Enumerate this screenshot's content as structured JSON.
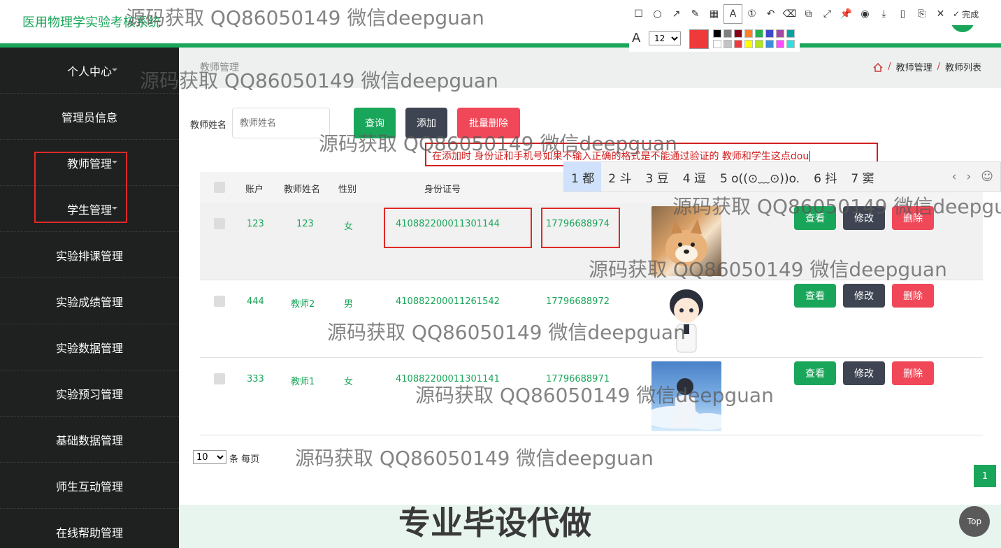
{
  "app": {
    "title": "医用物理学实验考核系统"
  },
  "sidebar": {
    "items": [
      {
        "label": "个人中心"
      },
      {
        "label": "管理员信息"
      },
      {
        "label": "教师管理"
      },
      {
        "label": "学生管理"
      },
      {
        "label": "实验排课管理"
      },
      {
        "label": "实验成绩管理"
      },
      {
        "label": "实验数据管理"
      },
      {
        "label": "实验预习管理"
      },
      {
        "label": "基础数据管理"
      },
      {
        "label": "师生互动管理"
      },
      {
        "label": "在线帮助管理"
      }
    ]
  },
  "breadcrumb": {
    "page_title": "教师管理",
    "trail": [
      "教师管理",
      "教师列表"
    ],
    "separator": "/"
  },
  "search": {
    "label": "教师姓名",
    "placeholder": "教师姓名",
    "query_button": "查询",
    "add_button": "添加",
    "batch_delete_button": "批量删除"
  },
  "ime": {
    "typed_text": "在添加时 身份证和手机号如果不输入正确的格式是不能通过验证的 教师和学生这点dou",
    "candidates": [
      "1 都",
      "2 斗",
      "3 豆",
      "4 逗",
      "5 o((⊙﹏⊙))o.",
      "6 抖",
      "7 窦"
    ],
    "nav_prev": "‹",
    "nav_next": "›",
    "emoji": "☺"
  },
  "table": {
    "headers": [
      "账户",
      "教师姓名",
      "性别",
      "身份证号"
    ],
    "rows": [
      {
        "account": "123",
        "name": "123",
        "gender": "女",
        "id_card": "410882200011301144",
        "phone": "17796688974",
        "avatar": "shiba-dog-photo"
      },
      {
        "account": "444",
        "name": "教师2",
        "gender": "男",
        "id_card": "410882200011261542",
        "phone": "17796688972",
        "avatar": "cartoon-boy"
      },
      {
        "account": "333",
        "name": "教师1",
        "gender": "女",
        "id_card": "410882200011301141",
        "phone": "17796688971",
        "avatar": "boy-sky-photo"
      }
    ],
    "actions": {
      "view": "查看",
      "edit": "修改",
      "delete": "删除"
    }
  },
  "pagination": {
    "page_size": "10",
    "page_size_suffix": "条 每页",
    "current_page": "1"
  },
  "top_button": "Top",
  "annotation_toolbar": {
    "done_label": "完成",
    "font_size": "12",
    "current_color": "#ee3a3a",
    "swatches": [
      "#000000",
      "#7f7f7f",
      "#880015",
      "#ff7f27",
      "#22b14c",
      "#3f48cc",
      "#a349a4",
      "#00a2a2",
      "#ffffff",
      "#c3c3c3",
      "#ee3a3a",
      "#ffff00",
      "#b5e61d",
      "#3a8eda",
      "#ff4aff",
      "#33dddd"
    ]
  },
  "watermark": {
    "text": "源码获取 QQ86050149 微信deepguan",
    "promo": "专业毕设代做"
  },
  "colors": {
    "accent": "#1aa65a",
    "sidebar_bg": "#1f2120",
    "danger": "#f04858",
    "dark_button": "#3e4451"
  }
}
